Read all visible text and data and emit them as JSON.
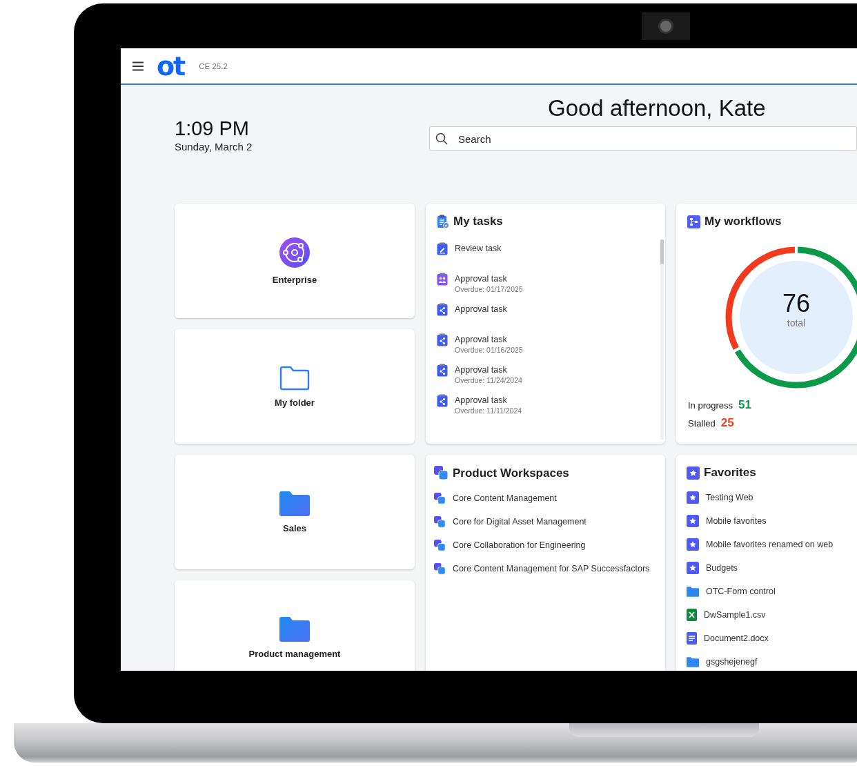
{
  "header": {
    "logo": "ot",
    "version": "CE 25.2"
  },
  "clock": {
    "time": "1:09 PM",
    "date": "Sunday, March 2"
  },
  "greeting": "Good afternoon, Kate",
  "search": {
    "placeholder": "Search"
  },
  "tiles": [
    {
      "label": "Enterprise",
      "kind": "enterprise"
    },
    {
      "label": "My folder",
      "kind": "folder-outline"
    },
    {
      "label": "Sales",
      "kind": "folder"
    },
    {
      "label": "Product management",
      "kind": "folder"
    }
  ],
  "tasks": {
    "title": "My tasks",
    "items": [
      {
        "label": "Review task",
        "kind": "review"
      },
      {
        "label": "Approval task",
        "due": "Overdue: 01/17/2025",
        "kind": "group"
      },
      {
        "label": "Approval task",
        "kind": "approval"
      },
      {
        "label": "Approval task",
        "due": "Overdue: 01/16/2025",
        "kind": "approval"
      },
      {
        "label": "Approval task",
        "due": "Overdue: 11/24/2024",
        "kind": "approval"
      },
      {
        "label": "Approval task",
        "due": "Overdue: 11/11/2024",
        "kind": "approval"
      }
    ]
  },
  "workflows": {
    "title": "My workflows",
    "total": "76",
    "total_label": "total",
    "stats": [
      {
        "label": "In progress",
        "value": "51",
        "color": "#0a9a4a"
      },
      {
        "label": "Stalled",
        "value": "25",
        "color": "#f23a1e"
      }
    ]
  },
  "workspaces": {
    "title": "Product Workspaces",
    "items": [
      "Core Content Management",
      "Core for Digital Asset Management",
      "Core Collaboration for Engineering",
      "Core Content Management for SAP Successfactors"
    ]
  },
  "favorites": {
    "title": "Favorites",
    "items": [
      {
        "label": "Testing Web",
        "kind": "favorite"
      },
      {
        "label": "Mobile favorites",
        "kind": "favorite"
      },
      {
        "label": "Mobile favorites renamed on web",
        "kind": "favorite"
      },
      {
        "label": "Budgets",
        "kind": "favorite"
      },
      {
        "label": "OTC-Form control",
        "kind": "folder"
      },
      {
        "label": "DwSample1.csv",
        "kind": "spreadsheet"
      },
      {
        "label": "Document2.docx",
        "kind": "document"
      },
      {
        "label": "gsgshejenegf",
        "kind": "folder"
      }
    ]
  }
}
